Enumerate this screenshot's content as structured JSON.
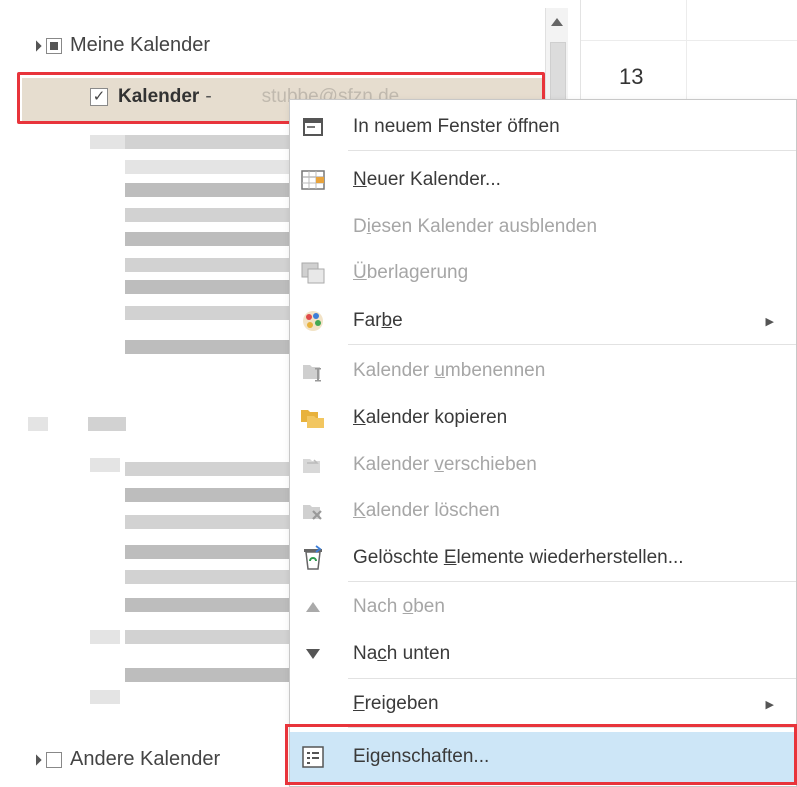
{
  "nav": {
    "my_calendars_label": "Meine Kalender",
    "calendar_item": {
      "name": "Kalender",
      "separator": "-",
      "email": "stubbe@sfzn.de"
    },
    "other_calendars_label": "Andere Kalender"
  },
  "grid": {
    "day_number": "13"
  },
  "menu": {
    "items": [
      {
        "pre": "In neuem Fenster ",
        "acc": "",
        "post": "öffnen",
        "icon": "open-window-icon"
      },
      {
        "pre": "",
        "acc": "N",
        "post": "euer Kalender...",
        "icon": "new-calendar-icon"
      },
      {
        "pre": "D",
        "acc": "i",
        "post": "esen Kalender ausblenden",
        "icon": ""
      },
      {
        "pre": "",
        "acc": "Ü",
        "post": "berlagerung",
        "icon": "overlay-icon"
      },
      {
        "pre": "Far",
        "acc": "b",
        "post": "e",
        "icon": "color-palette-icon"
      },
      {
        "pre": "Kalender ",
        "acc": "u",
        "post": "mbenennen",
        "icon": "rename-calendar-icon"
      },
      {
        "pre": "",
        "acc": "K",
        "post": "alender kopieren",
        "icon": "copy-calendar-icon"
      },
      {
        "pre": "Kalender ",
        "acc": "v",
        "post": "erschieben",
        "icon": "move-calendar-icon"
      },
      {
        "pre": "",
        "acc": "K",
        "post": "alender löschen",
        "icon": "delete-calendar-icon"
      },
      {
        "pre": "Gelöschte ",
        "acc": "E",
        "post": "lemente wiederherstellen...",
        "icon": "recover-items-icon"
      },
      {
        "pre": "Nach ",
        "acc": "o",
        "post": "ben",
        "icon": "move-up-icon"
      },
      {
        "pre": "Na",
        "acc": "c",
        "post": "h unten",
        "icon": "move-down-icon"
      },
      {
        "pre": "",
        "acc": "F",
        "post": "reigeben",
        "icon": ""
      },
      {
        "pre": "Eigenschaften...",
        "acc": "",
        "post": "",
        "icon": "properties-icon"
      }
    ]
  },
  "colors": {
    "highlight_frame": "#e8343b",
    "menu_hover": "#cde6f7",
    "selected_row": "#e6ddcf"
  }
}
